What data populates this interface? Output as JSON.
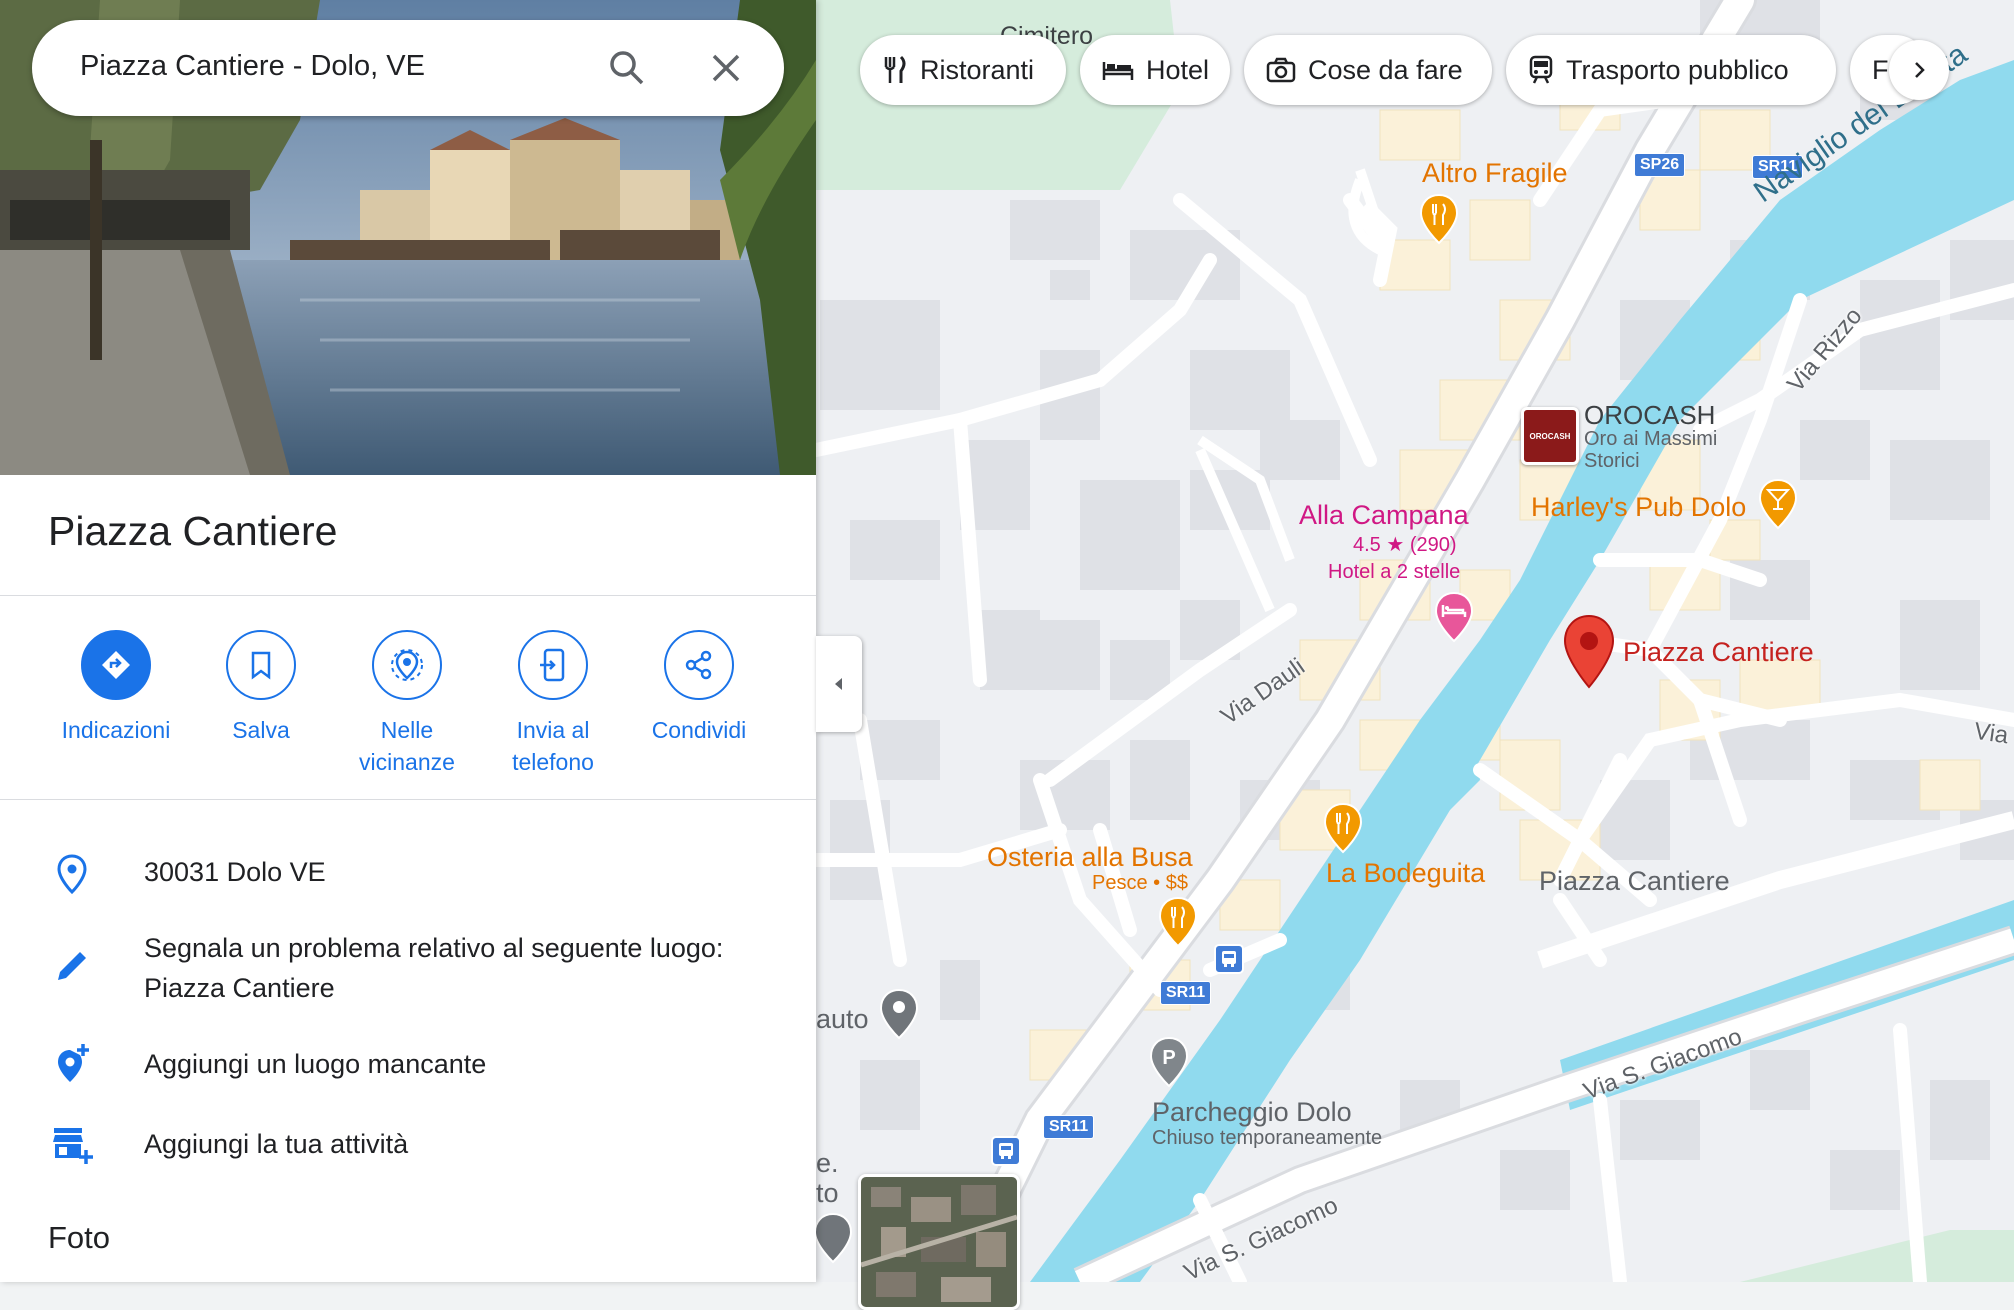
{
  "search": {
    "query": "Piazza Cantiere - Dolo, VE"
  },
  "categories": [
    {
      "label": "Ristoranti",
      "icon": "fork-knife-icon"
    },
    {
      "label": "Hotel",
      "icon": "bed-icon"
    },
    {
      "label": "Cose da fare",
      "icon": "camera-icon"
    },
    {
      "label": "Trasporto pubblico",
      "icon": "train-icon"
    },
    {
      "label": "F",
      "icon": ""
    }
  ],
  "place": {
    "title": "Piazza Cantiere"
  },
  "actions": [
    {
      "label": "Indicazioni",
      "icon": "directions-icon"
    },
    {
      "label": "Salva",
      "icon": "bookmark-icon"
    },
    {
      "label": "Nelle vicinanze",
      "icon": "nearby-icon"
    },
    {
      "label": "Invia al telefono",
      "icon": "send-to-phone-icon"
    },
    {
      "label": "Condividi",
      "icon": "share-icon"
    }
  ],
  "info": {
    "address": "30031 Dolo VE",
    "report_line1": "Segnala un problema relativo al seguente luogo:",
    "report_line2": "Piazza Cantiere",
    "add_place": "Aggiungi un luogo mancante",
    "add_business": "Aggiungi la tua attività"
  },
  "photos_heading": "Foto",
  "map": {
    "labels": {
      "cimitero": "Cimitero",
      "altro_fragile": "Altro Fragile",
      "orocash": "OROCASH",
      "orocash_sub1": "Oro ai Massimi",
      "orocash_sub2": "Storici",
      "orocash_logo": "OROCASH",
      "harleys": "Harley's Pub Dolo",
      "alla_campana": "Alla Campana",
      "alla_campana_rating": "4.5 ★ (290)",
      "alla_campana_type": "Hotel a 2 stelle",
      "piazza_pin": "Piazza Cantiere",
      "piazza_area": "Piazza Cantiere",
      "osteria": "Osteria alla Busa",
      "osteria_sub": "Pesce • $$",
      "bodeguita": "La Bodeguita",
      "parcheggio": "Parcheggio Dolo",
      "parcheggio_sub": "Chiuso temporaneamente",
      "auto": "auto",
      "e_dot": "e.",
      "to": "to"
    },
    "roads": {
      "naviglio": "Naviglio del Brenta",
      "via_rizzo": "Via Rizzo",
      "via_dauli": "Via Dauli",
      "via_right": "Via",
      "via_giacomo_1": "Via S. Giacomo",
      "via_giacomo_2": "Via S. Giacomo"
    },
    "shields": {
      "sp26": "SP26",
      "sr11_a": "SR11",
      "sr11_b": "SR11",
      "sr11_c": "SR11"
    }
  },
  "colors": {
    "accent": "#1a73e8",
    "water": "#90daee",
    "food": "#e37400",
    "hotel": "#d01884",
    "pin": "#ea4335"
  }
}
